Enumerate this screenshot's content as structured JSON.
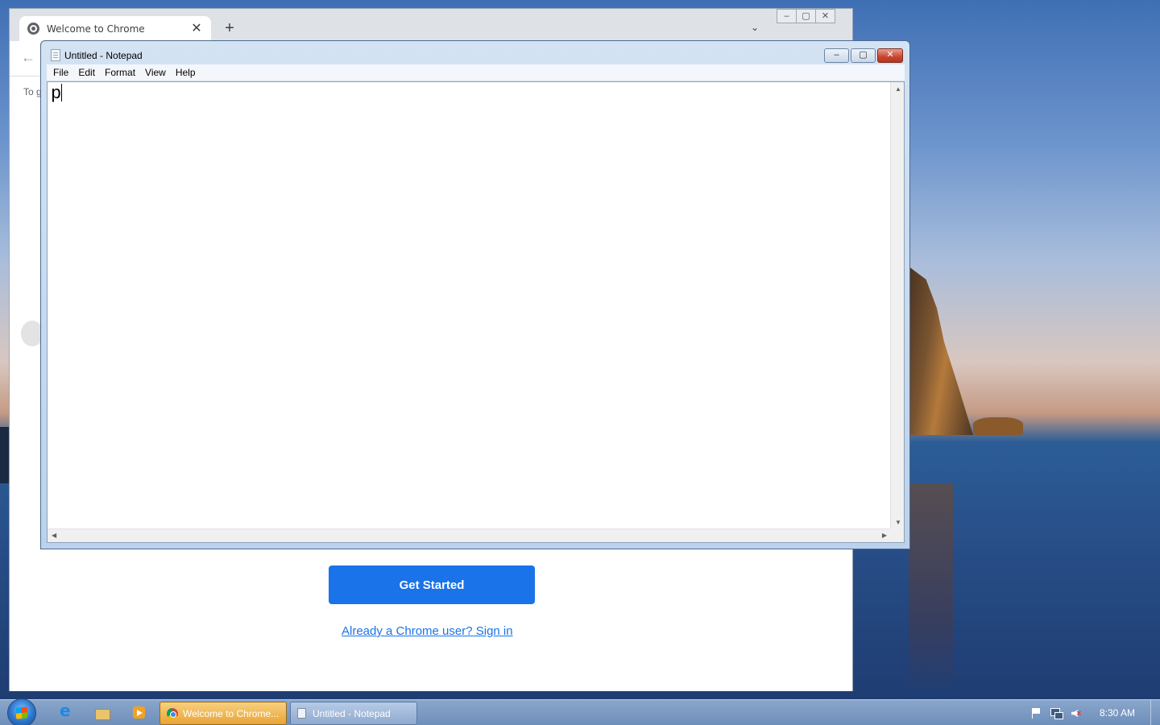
{
  "chrome": {
    "tab_title": "Welcome to Chrome",
    "tab_close": "✕",
    "new_tab": "+",
    "tab_dropdown": "⌄",
    "win_minimize": "–",
    "win_maximize": "▢",
    "win_close": "✕",
    "back": "←",
    "content_partial_text": "To g",
    "get_started_label": "Get Started",
    "signin_link": "Already a Chrome user? Sign in",
    "accent_color": "#1a73e8"
  },
  "notepad": {
    "title": "Untitled - Notepad",
    "menu": [
      "File",
      "Edit",
      "Format",
      "View",
      "Help"
    ],
    "text": "p",
    "btn_min": "–",
    "btn_max": "▢",
    "btn_close": "✕"
  },
  "taskbar": {
    "tasks": [
      {
        "label": "Welcome to Chrome...",
        "icon": "chrome-icon",
        "active": true
      },
      {
        "label": "Untitled - Notepad",
        "icon": "notepad-icon",
        "active": false
      }
    ],
    "pinned": [
      "internet-explorer-icon",
      "file-explorer-icon",
      "media-player-icon"
    ],
    "clock": "8:30 AM"
  }
}
